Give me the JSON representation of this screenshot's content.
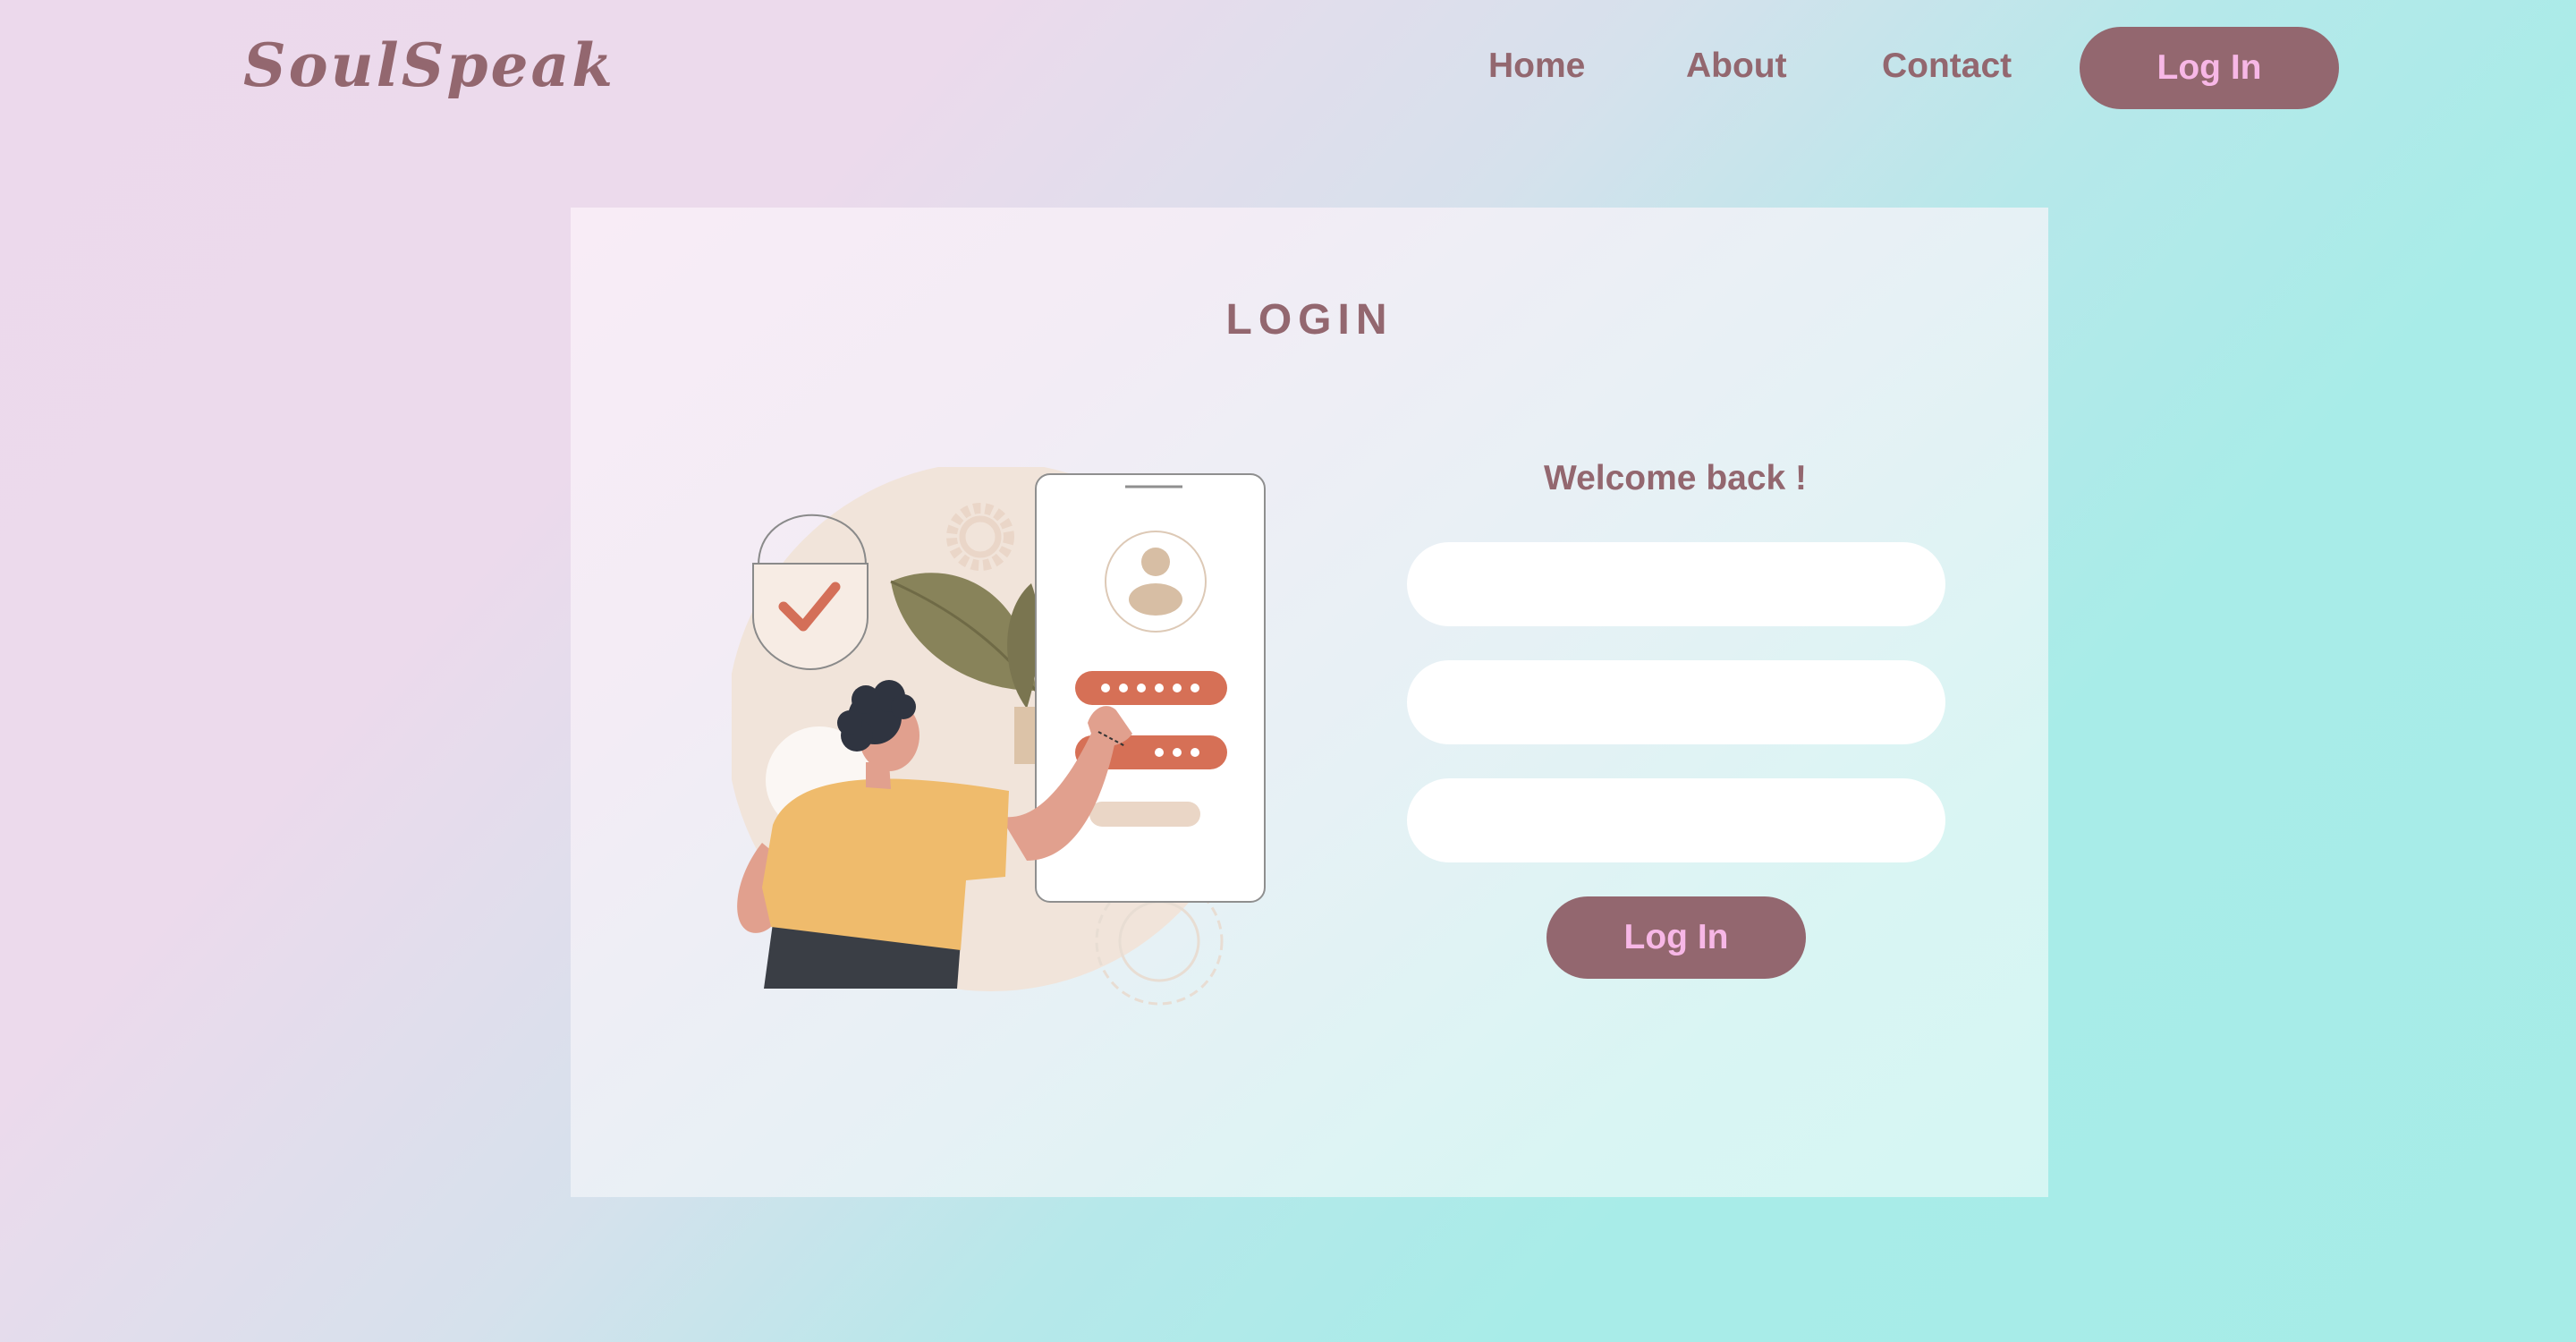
{
  "header": {
    "logo": "SoulSpeak",
    "nav": {
      "home": "Home",
      "about": "About",
      "contact": "Contact"
    },
    "login_button": "Log In"
  },
  "card": {
    "title": "LOGIN",
    "welcome": "Welcome back !",
    "fields": [
      {
        "value": "",
        "placeholder": ""
      },
      {
        "value": "",
        "placeholder": ""
      },
      {
        "value": "",
        "placeholder": ""
      }
    ],
    "login_button": "Log In",
    "illustration": "person-login-phone-illustration"
  },
  "colors": {
    "brand": "#93676f",
    "button_text": "#f7b7e6",
    "background_start": "#ecd9ec",
    "background_end": "#a6ece7",
    "card": "#f3ecf5"
  },
  "icons": [
    "lock-check-icon",
    "user-avatar-icon",
    "gear-icon",
    "leaf-icon"
  ]
}
